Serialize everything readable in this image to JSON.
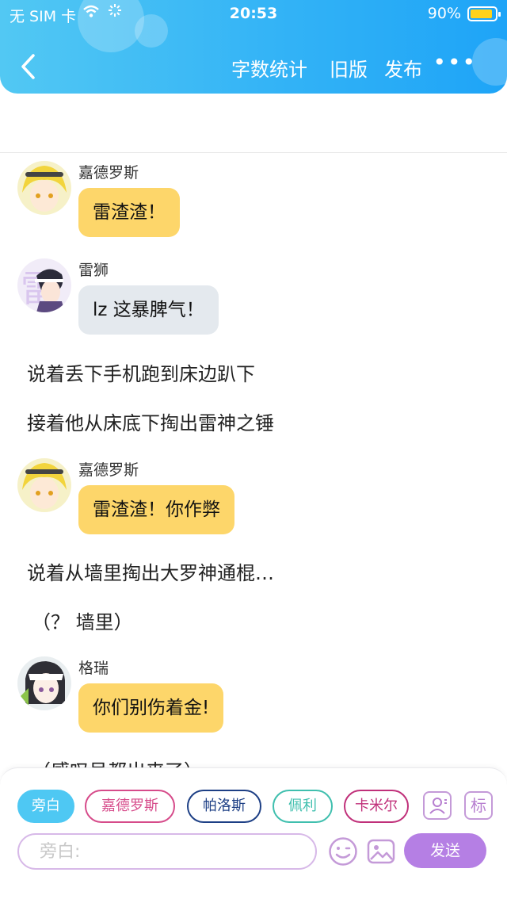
{
  "status": {
    "carrier": "无 SIM 卡",
    "time": "20:53",
    "battery": "90%",
    "battery_level": 0.9
  },
  "nav": {
    "word_count": "字数统计",
    "old_version": "旧版",
    "publish": "发布",
    "more": "•••"
  },
  "messages": [
    {
      "sender": "嘉德罗斯",
      "text": "雷渣渣！",
      "style": "yellow"
    },
    {
      "sender": "雷狮",
      "text": "lz 这暴脾气！",
      "style": "gray"
    },
    {
      "narration": "说着丢下手机跑到床边趴下"
    },
    {
      "narration": "接着他从床底下掏出雷神之锤"
    },
    {
      "sender": "嘉德罗斯",
      "text": "雷渣渣！你作弊",
      "style": "yellow"
    },
    {
      "narration": "说着从墙里掏出大罗神通棍…"
    },
    {
      "narration": "（？ 墙里）"
    },
    {
      "sender": "格瑞",
      "text": "你们别伤着金!",
      "style": "yellow"
    },
    {
      "narration": "（感叹号都出来了）"
    }
  ],
  "characters": [
    {
      "label": "旁白",
      "color": "#4ec8f3",
      "active": true
    },
    {
      "label": "嘉德罗斯",
      "color": "#d64b8a",
      "active": false
    },
    {
      "label": "帕洛斯",
      "color": "#1d3f85",
      "active": false
    },
    {
      "label": "佩利",
      "color": "#3fbfae",
      "active": false
    },
    {
      "label": "卡米尔",
      "color": "#c0307a",
      "active": false
    }
  ],
  "tools": {
    "tag_label": "标",
    "person_icon": "person-card-icon",
    "emoji_icon": "smile-icon",
    "image_icon": "image-icon"
  },
  "composer": {
    "placeholder": "旁白:",
    "send_label": "发送"
  }
}
